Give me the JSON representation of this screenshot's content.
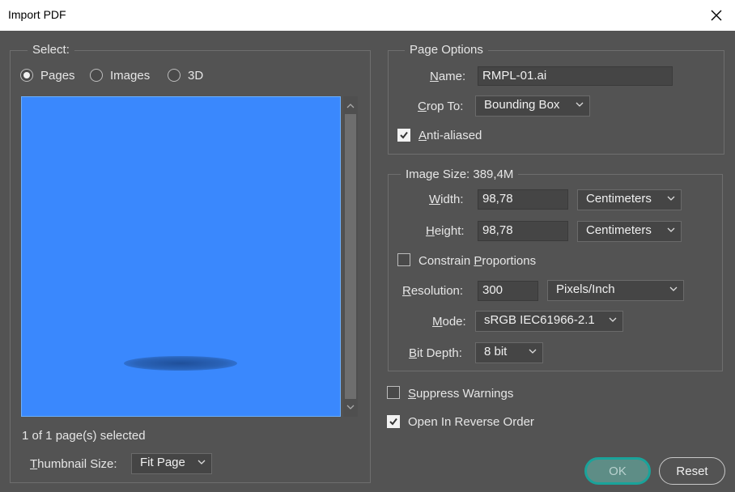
{
  "window": {
    "title": "Import PDF",
    "close_icon": "close-icon"
  },
  "select_panel": {
    "legend": "Select:",
    "options": [
      {
        "label": "Pages",
        "selected": true
      },
      {
        "label": "Images",
        "selected": false
      },
      {
        "label": "3D",
        "selected": false
      }
    ],
    "status": "1 of 1 page(s) selected",
    "thumbnail_label": "Thumbnail Size:",
    "thumbnail_value": "Fit Page",
    "preview_color": "#3a88fd"
  },
  "page_options": {
    "legend": "Page Options",
    "name_label": "Name:",
    "name_value": "RMPL-01.ai",
    "crop_label": "Crop To:",
    "crop_value": "Bounding Box",
    "anti_aliased_label": "Anti-aliased",
    "anti_aliased": true
  },
  "image_size": {
    "legend": "Image Size: 389,4M",
    "width_label": "Width:",
    "width_value": "98,78",
    "width_unit": "Centimeters",
    "height_label": "Height:",
    "height_value": "98,78",
    "height_unit": "Centimeters",
    "constrain_label": "Constrain Proportions",
    "constrain": false,
    "resolution_label": "Resolution:",
    "resolution_value": "300",
    "resolution_unit": "Pixels/Inch",
    "mode_label": "Mode:",
    "mode_value": "sRGB IEC61966-2.1",
    "bitdepth_label": "Bit Depth:",
    "bitdepth_value": "8 bit"
  },
  "options": {
    "suppress_label": "Suppress Warnings",
    "suppress": false,
    "reverse_label": "Open In Reverse Order",
    "reverse": true
  },
  "buttons": {
    "ok": "OK",
    "reset": "Reset"
  },
  "colors": {
    "accent": "#1aa39a",
    "background": "#535353",
    "titlebar": "#ffffff"
  }
}
